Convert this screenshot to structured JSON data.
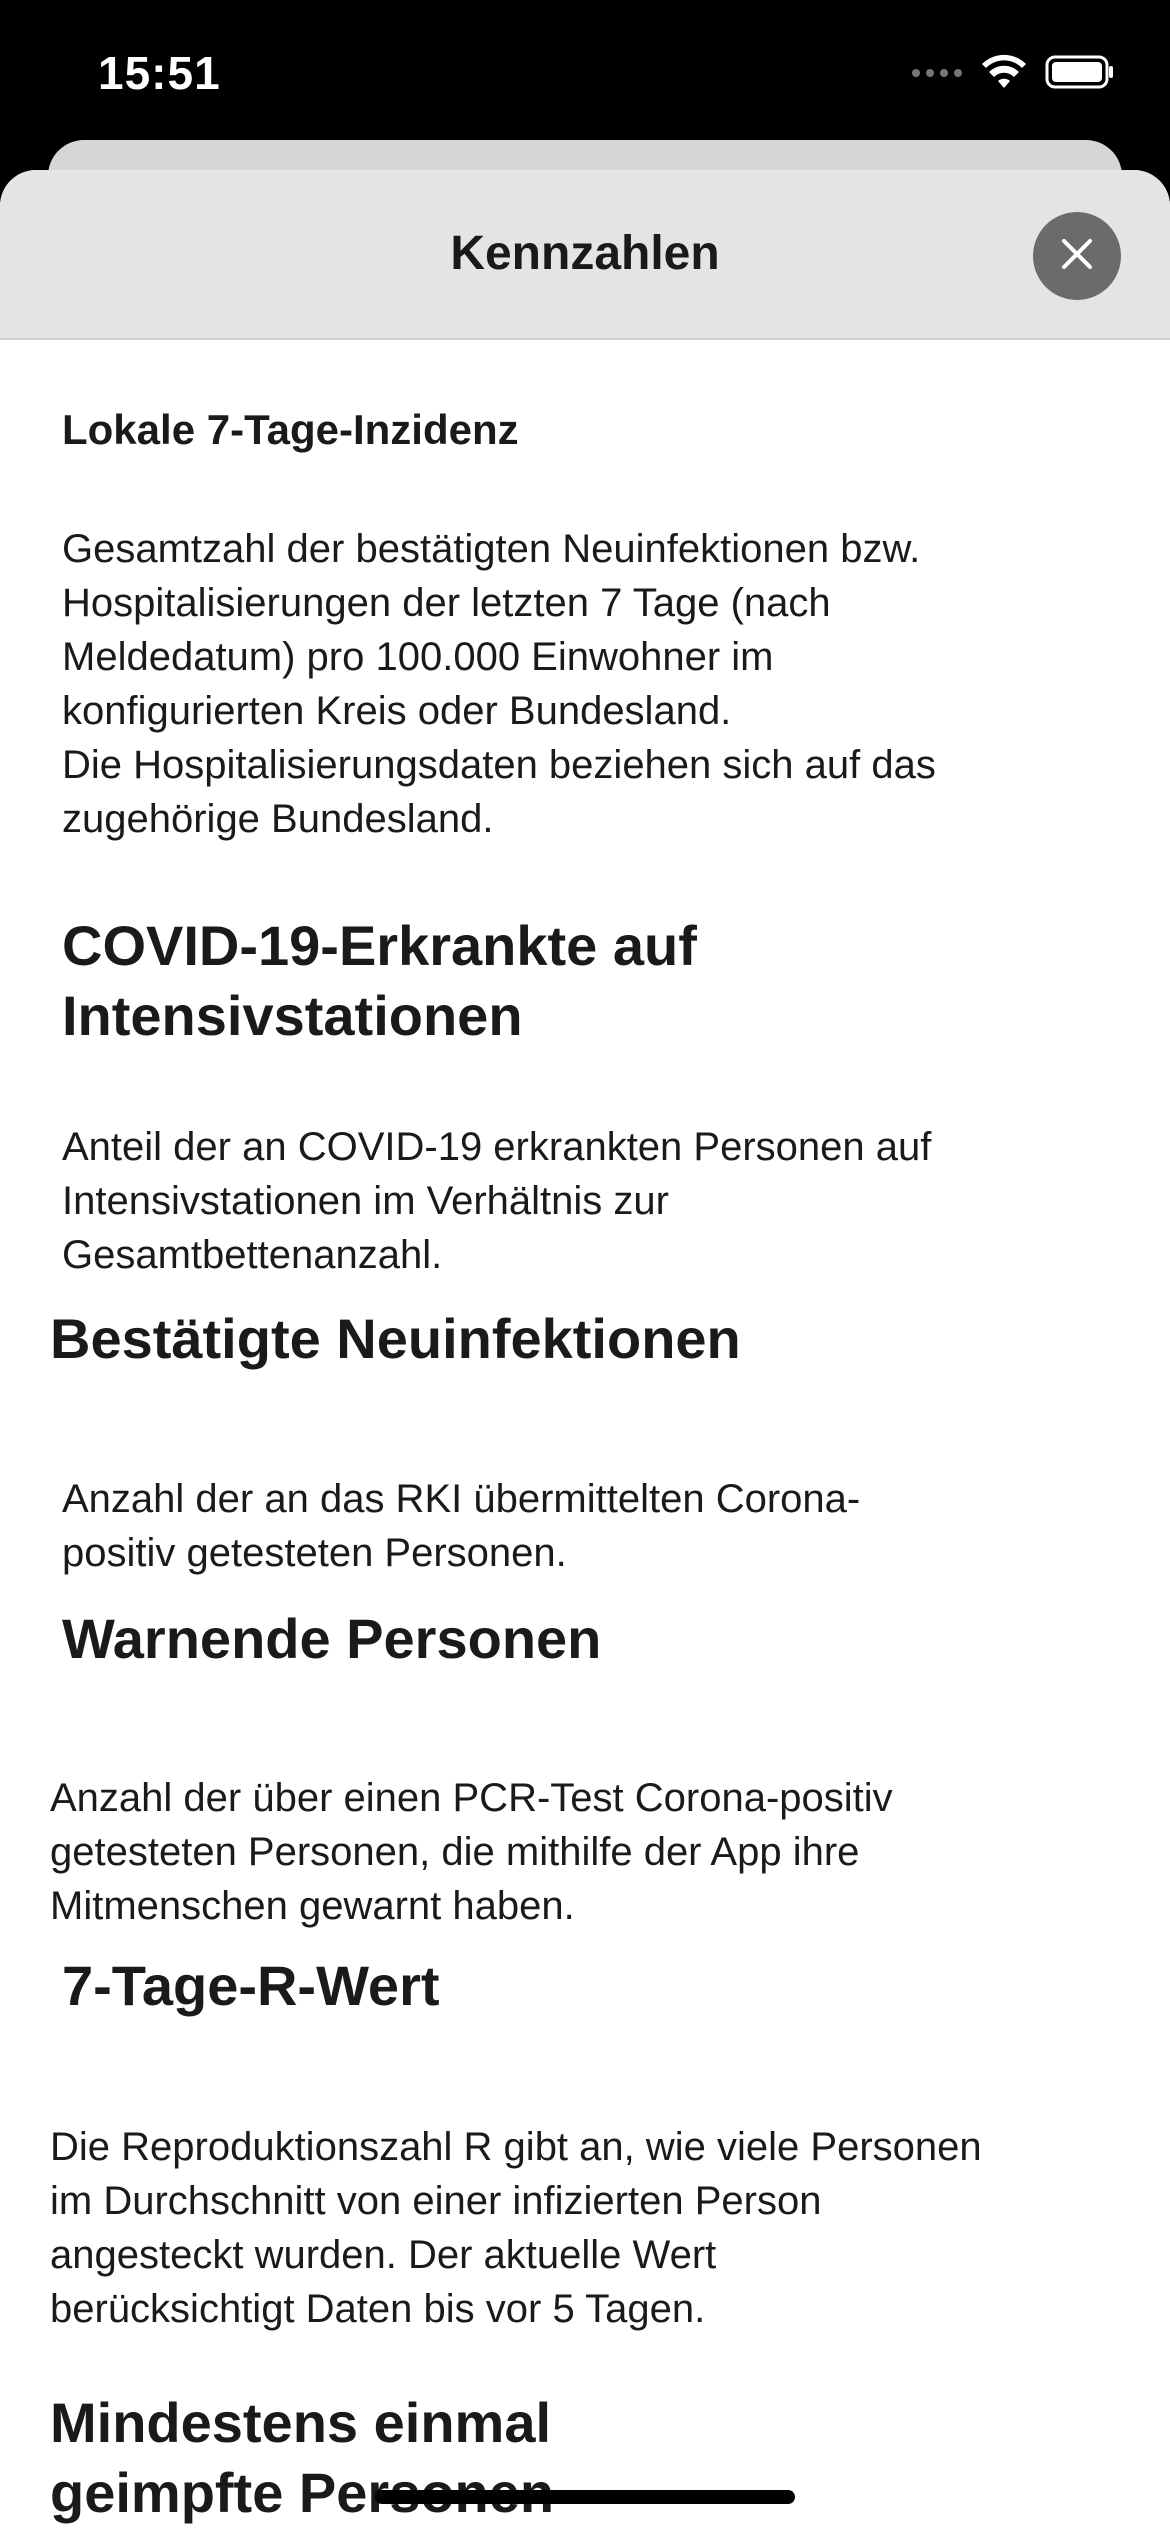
{
  "status_bar": {
    "time": "15:51"
  },
  "sheet": {
    "title": "Kennzahlen",
    "close_icon": "close-icon"
  },
  "sections": [
    {
      "heading": "Lokale 7-Tage-Inzidenz",
      "text": "Gesamtzahl der bestätigten Neuinfektionen bzw.\nHospitalisierungen der letzten 7 Tage (nach\nMeldedatum) pro 100.000 Einwohner im\nkonfigurierten Kreis oder Bundesland.\nDie Hospitalisierungsdaten beziehen sich auf das\nzugehörige Bundesland."
    },
    {
      "heading": "COVID-19-Erkrankte auf\nIntensivstationen",
      "text": "Anteil der an COVID-19 erkrankten Personen auf\nIntensivstationen im Verhältnis zur\nGesamtbettenanzahl."
    },
    {
      "heading": "Bestätigte Neuinfektionen",
      "text": "Anzahl der an das RKI übermittelten Corona-\npositiv getesteten Personen."
    },
    {
      "heading": "Warnende Personen",
      "text": "Anzahl der über einen PCR-Test Corona-positiv\ngetesteten Personen, die mithilfe der App ihre\nMitmenschen gewarnt haben."
    },
    {
      "heading": "7-Tage-R-Wert",
      "text": "Die Reproduktionszahl R gibt an, wie viele Personen\nim Durchschnitt von einer infizierten Person\nangesteckt wurden. Der aktuelle Wert\nberücksichtigt Daten bis vor 5 Tagen."
    },
    {
      "heading": "Mindestens einmal\ngeimpfte Personen"
    }
  ],
  "colors": {
    "background": "#ffffff",
    "header": "#e4e4e4",
    "close_button": "#6b6b6b",
    "text": "#1a1a1a"
  }
}
